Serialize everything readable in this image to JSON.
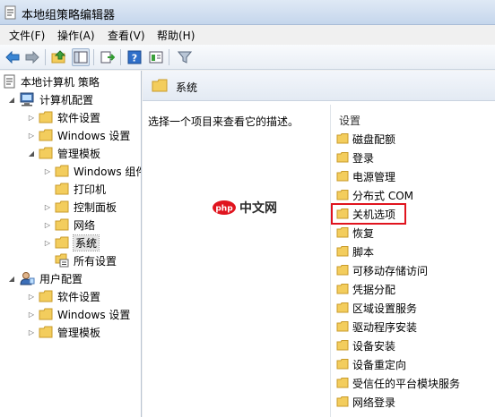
{
  "window": {
    "title": "本地组策略编辑器"
  },
  "menu": [
    {
      "label": "文件(F)"
    },
    {
      "label": "操作(A)"
    },
    {
      "label": "查看(V)"
    },
    {
      "label": "帮助(H)"
    }
  ],
  "tree": {
    "root": "本地计算机 策略",
    "computer_config": "计算机配置",
    "software_settings_1": "软件设置",
    "windows_settings_1": "Windows 设置",
    "admin_templates_1": "管理模板",
    "windows_components": "Windows 组件",
    "printers": "打印机",
    "control_panel": "控制面板",
    "network": "网络",
    "system": "系统",
    "all_settings": "所有设置",
    "user_config": "用户配置",
    "software_settings_2": "软件设置",
    "windows_settings_2": "Windows 设置",
    "admin_templates_2": "管理模板"
  },
  "right_pane": {
    "header_title": "系统",
    "description": "选择一个项目来查看它的描述。",
    "column_header": "设置",
    "items": [
      "磁盘配额",
      "登录",
      "电源管理",
      "分布式 COM",
      "关机选项",
      "恢复",
      "脚本",
      "可移动存储访问",
      "凭据分配",
      "区域设置服务",
      "驱动程序安装",
      "设备安装",
      "设备重定向",
      "受信任的平台模块服务",
      "网络登录"
    ]
  },
  "watermark": {
    "logo_text": "php",
    "text": "中文网"
  },
  "colors": {
    "folder": "#f3cd5d",
    "highlight": "#e0141e"
  }
}
